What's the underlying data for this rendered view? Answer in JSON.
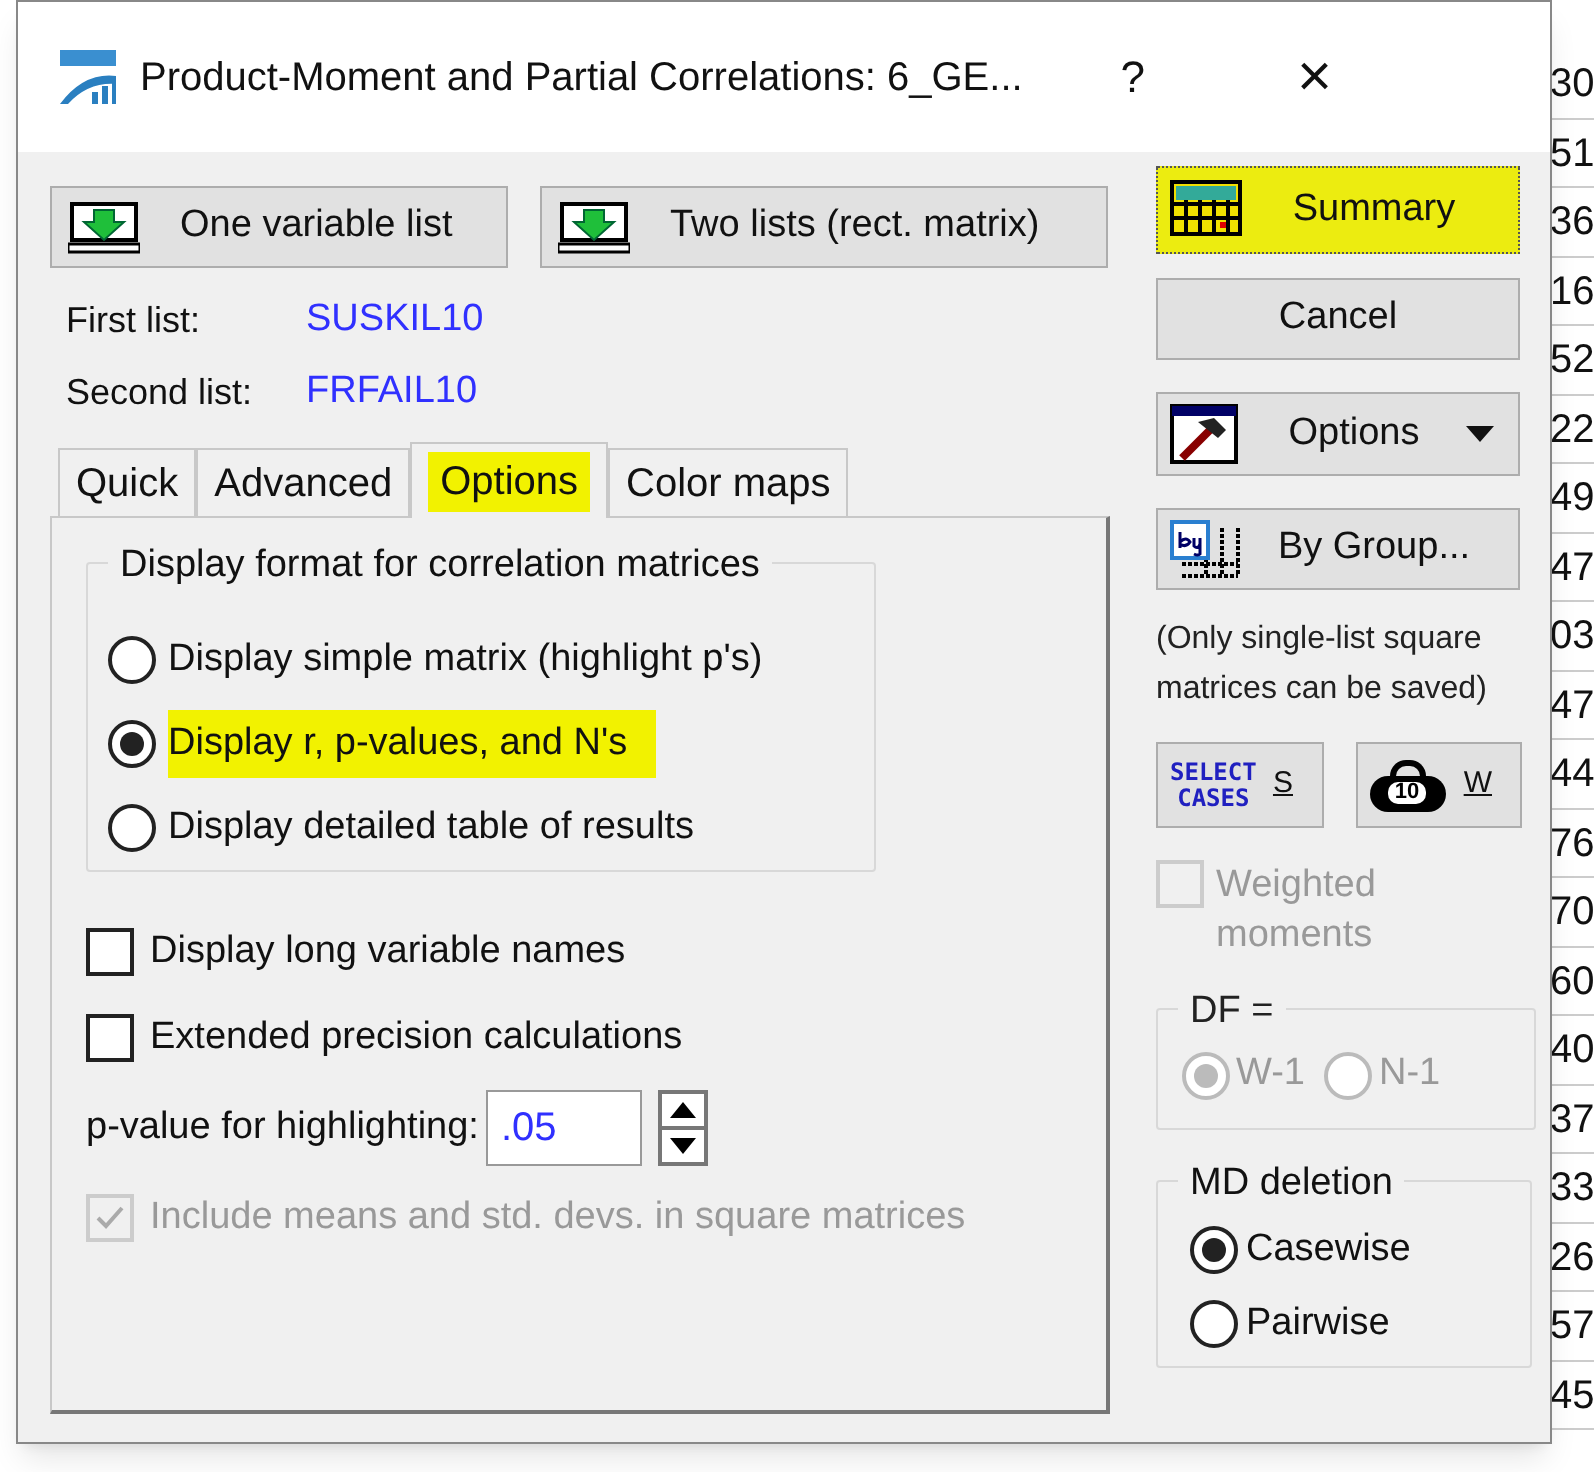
{
  "window": {
    "title": "Product-Moment and Partial Correlations: 6_GE...",
    "help": "?",
    "close": "×"
  },
  "list_buttons": [
    {
      "label": "One variable list"
    },
    {
      "label": "Two lists (rect. matrix)"
    }
  ],
  "lists": [
    {
      "label": "First list:",
      "value": "SUSKIL10"
    },
    {
      "label": "Second list:",
      "value": "FRFAIL10"
    }
  ],
  "tabs": [
    {
      "label": "Quick",
      "selected": false,
      "highlighted": false
    },
    {
      "label": "Advanced",
      "selected": false,
      "highlighted": false
    },
    {
      "label": "Options",
      "selected": true,
      "highlighted": true
    },
    {
      "label": "Color maps",
      "selected": false,
      "highlighted": false
    }
  ],
  "display_format": {
    "title": "Display format for correlation matrices",
    "options": [
      {
        "label": "Display simple matrix (highlight p's)",
        "selected": false,
        "highlighted": false
      },
      {
        "label": "Display r, p-values, and N's",
        "selected": true,
        "highlighted": true
      },
      {
        "label": "Display detailed table of results",
        "selected": false,
        "highlighted": false
      }
    ]
  },
  "checkboxes": [
    {
      "label": "Display long variable names",
      "checked": false
    },
    {
      "label": "Extended precision calculations",
      "checked": false
    }
  ],
  "p_value": {
    "label": "p-value for highlighting:",
    "value": ".05"
  },
  "include_means": {
    "label": "Include means and std. devs. in square matrices",
    "checked": true,
    "disabled": true
  },
  "side_buttons": [
    {
      "kind": "summary",
      "label": "Summary",
      "highlighted": true
    },
    {
      "kind": "plain",
      "label": "Cancel",
      "highlighted": false
    },
    {
      "kind": "menu",
      "label": "Options",
      "highlighted": false
    },
    {
      "kind": "bygroup",
      "label": "By Group...",
      "highlighted": false
    }
  ],
  "note": "(Only single-list square matrices can be saved)",
  "small_buttons": [
    {
      "kind": "select",
      "icon_text": [
        "SELECT",
        "CASES"
      ],
      "label": "S"
    },
    {
      "kind": "weight",
      "icon_text": [
        "10"
      ],
      "label": "W"
    }
  ],
  "weighted": {
    "label": "Weighted moments",
    "checked": false,
    "disabled": true
  },
  "df": {
    "title": "DF =",
    "disabled": true,
    "options": [
      {
        "label": "W-1",
        "selected": true
      },
      {
        "label": "N-1",
        "selected": false
      }
    ]
  },
  "md_deletion": {
    "title": "MD deletion",
    "options": [
      {
        "label": "Casewise",
        "selected": true
      },
      {
        "label": "Pairwise",
        "selected": false
      }
    ]
  },
  "sheet": {
    "right_column": [
      "30",
      "51",
      "36",
      "16",
      "52",
      "22",
      "49",
      "47",
      "03",
      "47",
      "44",
      "76",
      "70",
      "60",
      "40",
      "37",
      "33",
      "26",
      "57",
      "45"
    ]
  }
}
